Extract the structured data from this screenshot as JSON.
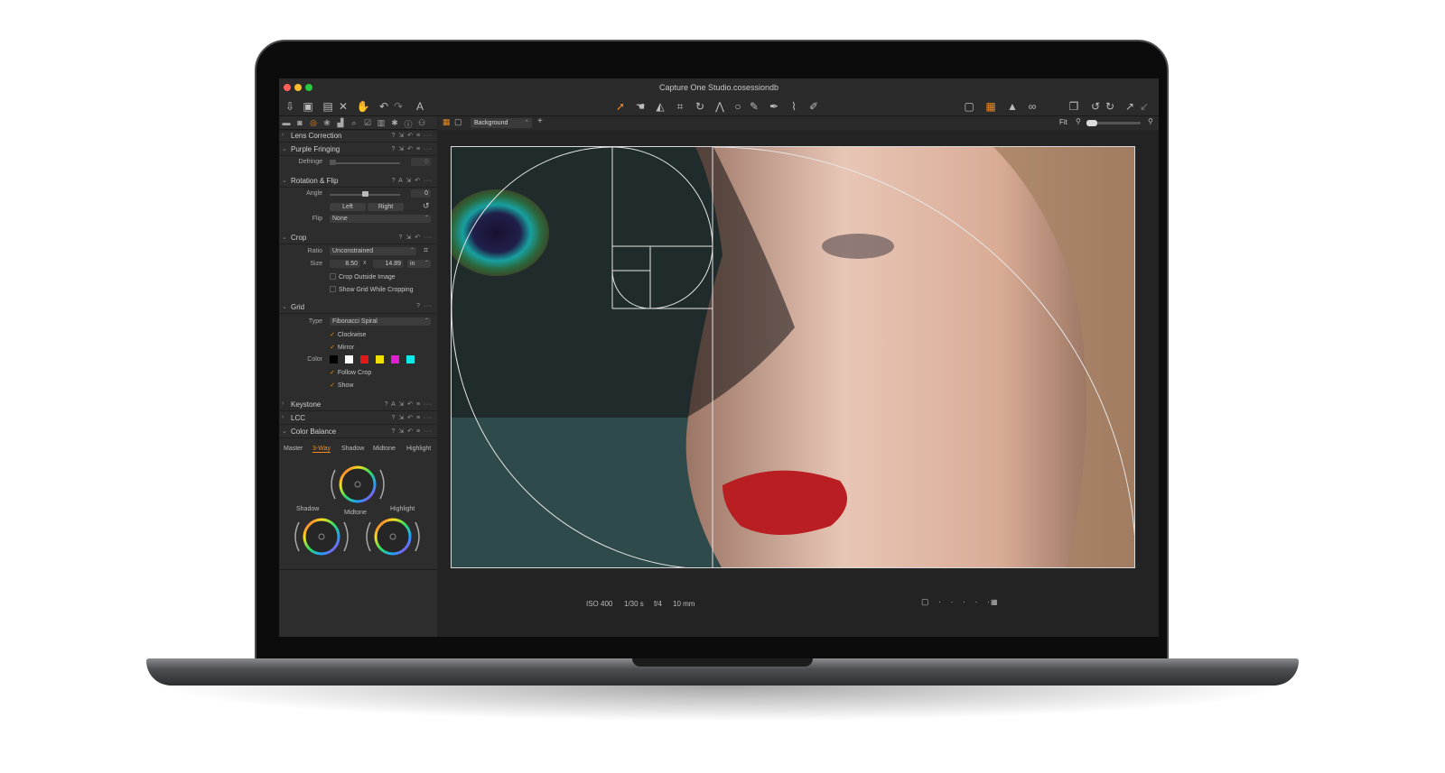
{
  "window": {
    "title": "Capture One Studio.cosessiondb"
  },
  "viewer_bar": {
    "background_select": "Background",
    "fit_label": "Fit"
  },
  "panels": {
    "lens_correction": {
      "title": "Lens Correction"
    },
    "purple_fringing": {
      "title": "Purple Fringing",
      "defringe_label": "Defringe",
      "defringe_value": "0"
    },
    "rotation_flip": {
      "title": "Rotation & Flip",
      "angle_label": "Angle",
      "angle_value": "0",
      "left_button": "Left",
      "right_button": "Right",
      "flip_label": "Flip",
      "flip_value": "None"
    },
    "crop": {
      "title": "Crop",
      "ratio_label": "Ratio",
      "ratio_value": "Unconstrained",
      "size_label": "Size",
      "width": "8.50",
      "times": "x",
      "height": "14.89",
      "unit": "in",
      "crop_outside": "Crop Outside Image",
      "show_grid_cropping": "Show Grid While Cropping"
    },
    "grid": {
      "title": "Grid",
      "type_label": "Type",
      "type_value": "Fibonacci Spiral",
      "clockwise": "Clockwise",
      "mirror": "Mirror",
      "color_label": "Color",
      "colors": [
        "#000000",
        "#ffffff",
        "#e01818",
        "#f0e000",
        "#e020d0",
        "#10e8e8"
      ],
      "follow_crop": "Follow Crop",
      "show": "Show"
    },
    "keystone": {
      "title": "Keystone"
    },
    "lcc": {
      "title": "LCC"
    },
    "color_balance": {
      "title": "Color Balance",
      "tabs": [
        "Master",
        "3-Way",
        "Shadow",
        "Midtone",
        "Highlight"
      ],
      "active_tab": "3-Way",
      "wheel_shadow": "Shadow",
      "wheel_midtone": "Midtone",
      "wheel_highlight": "Highlight"
    }
  },
  "viewer": {
    "iso": "ISO 400",
    "shutter": "1/30 s",
    "aperture": "f/4",
    "focal": "10 mm"
  },
  "colors": {
    "accent": "#f08a1c",
    "panel": "#2d2d2d",
    "viewer": "#232323"
  }
}
